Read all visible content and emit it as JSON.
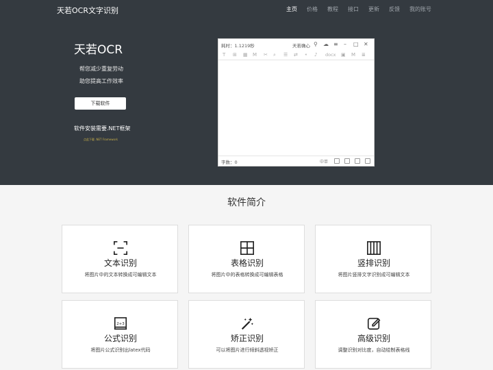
{
  "header": {
    "brand": "天若OCR文字识别"
  },
  "nav": [
    {
      "label": "主页",
      "active": true
    },
    {
      "label": "价格"
    },
    {
      "label": "教程"
    },
    {
      "label": "接口"
    },
    {
      "label": "更新"
    },
    {
      "label": "反馈"
    },
    {
      "label": "我的账号"
    }
  ],
  "hero": {
    "title": "天若OCR",
    "tagline1": "帮您减少重复劳动",
    "tagline2": "助您提高工作效率",
    "download_label": "下载软件",
    "requirement": "软件安装需要.NET框架",
    "framework_link": "点此下载 .NET Framework"
  },
  "app_window": {
    "time_label": "耗时：1.1219秒",
    "app_name": "天若确心",
    "docx_label": "docx",
    "m_label": "M",
    "word_count": "字数：0",
    "lang": "中单"
  },
  "intro": {
    "title": "软件简介"
  },
  "features": [
    {
      "title": "文本识别",
      "desc": "将图片中的文本转换成可编辑文本",
      "icon": "scan-text-icon"
    },
    {
      "title": "表格识别",
      "desc": "将图片中的表格转换成可编辑表格",
      "icon": "table-icon"
    },
    {
      "title": "竖排识别",
      "desc": "将图片竖排文字识别成可编辑文本",
      "icon": "vertical-columns-icon"
    },
    {
      "title": "公式识别",
      "desc": "将图片公式识别出latex代码",
      "icon": "formula-icon"
    },
    {
      "title": "矫正识别",
      "desc": "可以将图片进行倾斜透视矫正",
      "icon": "magic-wand-icon"
    },
    {
      "title": "高级识别",
      "desc": "调整识别对比度，自动绘制表格线",
      "icon": "edit-icon"
    }
  ]
}
